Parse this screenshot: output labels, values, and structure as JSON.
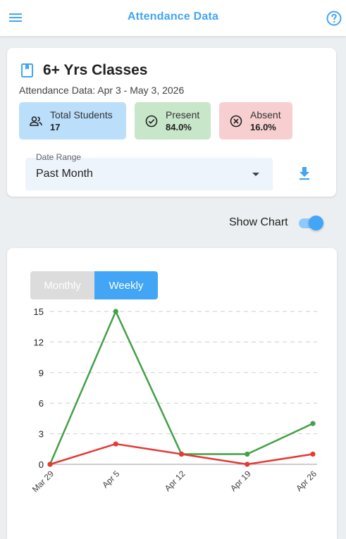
{
  "app": {
    "title": "Attendance Data",
    "icons": {
      "menu": "menu-icon",
      "help": "help-circle-icon"
    }
  },
  "class_card": {
    "title": "6+ Yrs Classes",
    "subtitle": "Attendance Data: Apr 3 - May 3, 2026",
    "icon": "book-icon",
    "stats": {
      "total": {
        "label": "Total Students",
        "value": "17",
        "icon": "people-icon",
        "color": "#bbdefb"
      },
      "present": {
        "label": "Present",
        "value": "84.0%",
        "icon": "check-circle-icon",
        "color": "#c8e6c9"
      },
      "absent": {
        "label": "Absent",
        "value": "16.0%",
        "icon": "cancel-circle-icon",
        "color": "#f8cfd1"
      }
    },
    "date_range": {
      "label": "Date Range",
      "value": "Past Month"
    },
    "download_icon": "download-icon"
  },
  "chart_toggle": {
    "label": "Show Chart",
    "on": true
  },
  "view_toggle": {
    "monthly": "Monthly",
    "weekly": "Weekly",
    "selected": "Weekly"
  },
  "colors": {
    "accent": "#42a5f5",
    "present": "#43a047",
    "absent": "#e53935"
  },
  "chart_data": {
    "type": "line",
    "x": [
      "Mar 29",
      "Apr 5",
      "Apr 12",
      "Apr 19",
      "Apr 26"
    ],
    "ylim": [
      0,
      15
    ],
    "yticks": [
      0,
      3,
      6,
      9,
      12,
      15
    ],
    "grid": true,
    "legend": "none",
    "series": [
      {
        "values": [
          0,
          15,
          1,
          1,
          4
        ],
        "color": "#43a047"
      },
      {
        "values": [
          0,
          2,
          1,
          0,
          1
        ],
        "color": "#e53935"
      }
    ]
  }
}
